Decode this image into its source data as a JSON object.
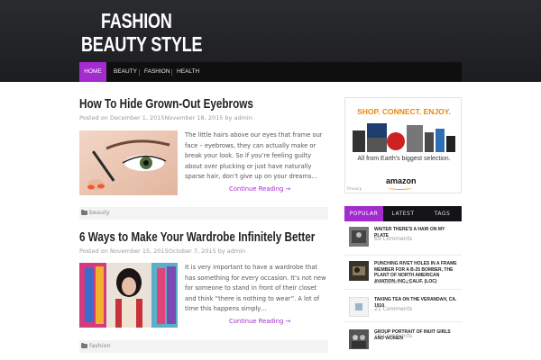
{
  "site": {
    "title_line1": "FASHION",
    "title_line2": "BEAUTY STYLE"
  },
  "nav": {
    "items": [
      "HOME",
      "BEAUTY",
      "FASHION",
      "HEALTH"
    ],
    "active": "HOME"
  },
  "posts": [
    {
      "title": "How To Hide Grown-Out Eyebrows",
      "meta": "Posted on December 1, 2015November 18, 2015 by admin",
      "excerpt": "The little hairs above our eyes that frame our face – eyebrows, they can actually make or break your look. So if you’re feeling guilty about over plucking or just have naturally sparse hair, don’t give up on your dreams…",
      "read_more": "Continue Reading →",
      "category": "beauty"
    },
    {
      "title": "6 Ways to Make Your Wardrobe Infinitely Better",
      "meta": "Posted on November 15, 2015October 7, 2015 by admin",
      "excerpt": "It is very important to have a wardrobe that has something for every occasion. It’s not new for someone to stand in front of their closet and think “there is nothing to wear”. A lot of time this happens simply…",
      "read_more": "Continue Reading →",
      "category": "fashion"
    }
  ],
  "ad": {
    "headline": "SHOP. CONNECT. ENJOY.",
    "tagline": "All from Earth's biggest selection.",
    "brand": "amazon",
    "privacy": "Privacy"
  },
  "sidebar_tabs": [
    "POPULAR",
    "LATEST",
    "TAGS"
  ],
  "popular": [
    {
      "title": "Waiter There's a Hair on My Plate",
      "comments": "69 Comments"
    },
    {
      "title": "Punching rivet holes in a frame member for a B-25 bomber, the plant of North American Aviation, Inc., Calif. (LOC)",
      "comments": "24 Comments"
    },
    {
      "title": "Taking tea on the verandah, ca. 1910",
      "comments": "21 Comments"
    },
    {
      "title": "Group portrait of Inuit girls and women",
      "comments": "19 Comments"
    }
  ],
  "colors": {
    "accent": "#a32bcf",
    "header_bg": "#1c1d20",
    "nav_bg": "#0f0f10"
  }
}
